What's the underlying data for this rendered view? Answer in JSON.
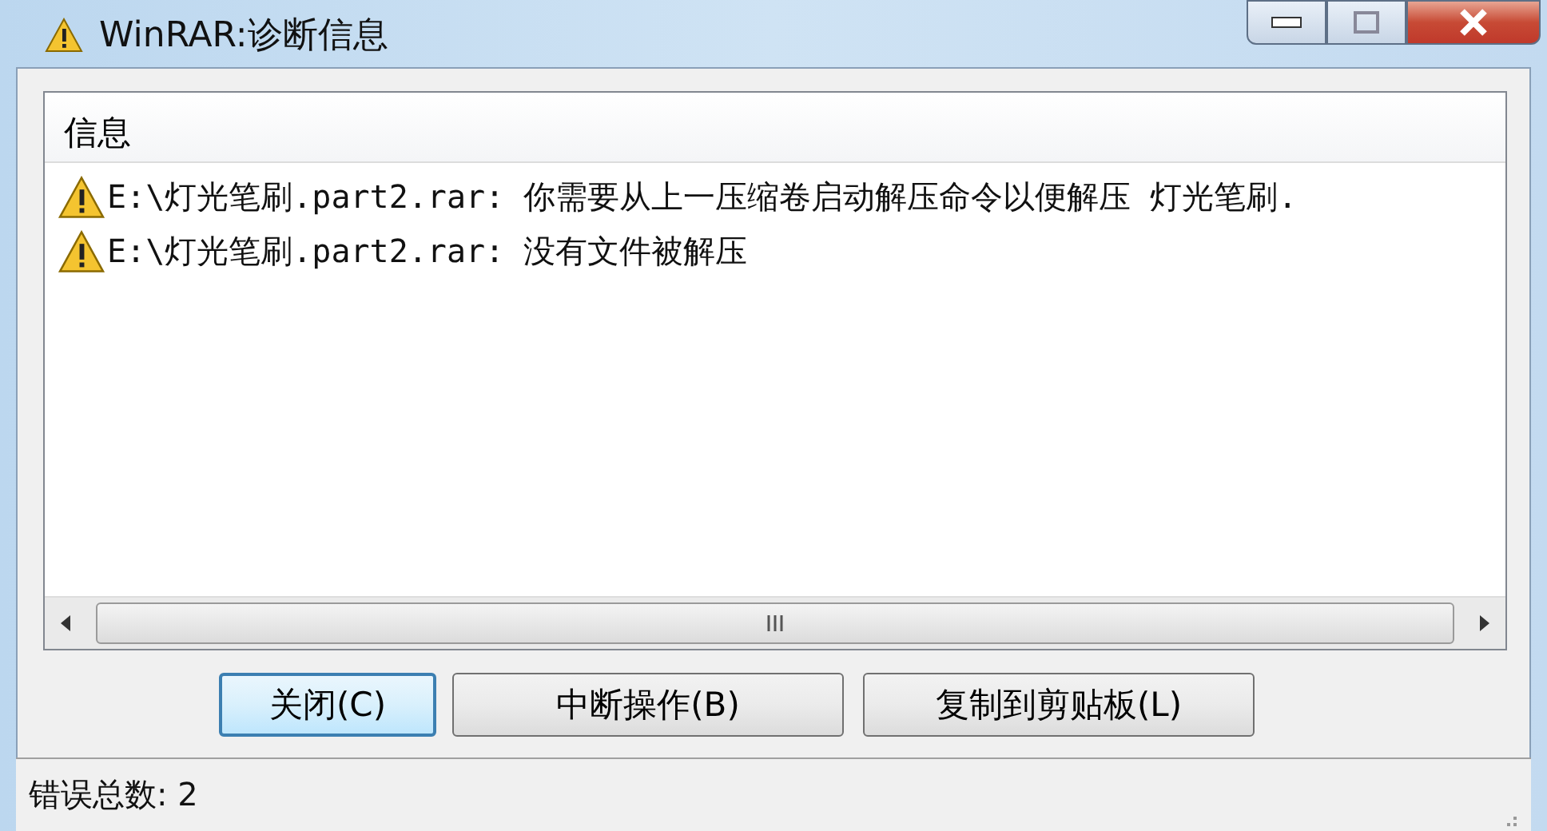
{
  "window": {
    "title": "WinRAR:诊断信息"
  },
  "list": {
    "column": "信息",
    "rows": [
      {
        "kind": "warning",
        "text": "E:\\灯光笔刷.part2.rar: 你需要从上一压缩卷启动解压命令以便解压 灯光笔刷."
      },
      {
        "kind": "warning",
        "text": "E:\\灯光笔刷.part2.rar: 没有文件被解压"
      }
    ]
  },
  "buttons": [
    {
      "label": "关闭(C)",
      "focused": true
    },
    {
      "label": "中断操作(B)",
      "focused": false
    },
    {
      "label": "复制到剪贴板(L)",
      "focused": false
    }
  ],
  "status_bar": {
    "text": "错误总数: 2"
  }
}
